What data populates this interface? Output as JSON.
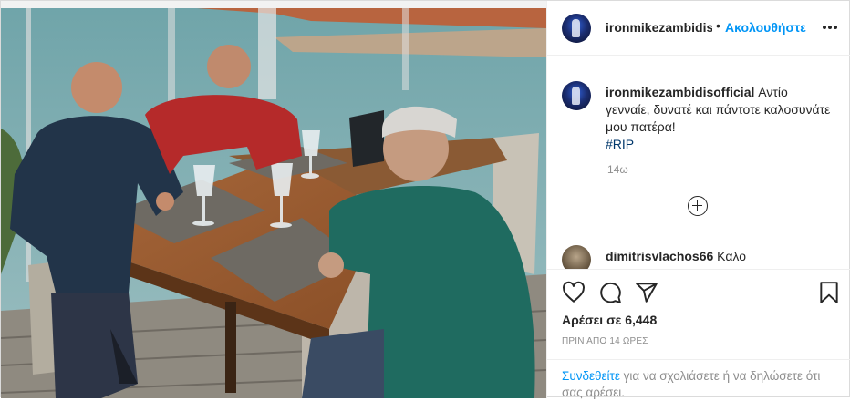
{
  "post": {
    "photo_alt": "Τέσσερις άνδρες κάθονται σε τραπέζι με θέα τη θάλασσα"
  },
  "header": {
    "username": "ironmikezambidisofficial",
    "separator": "•",
    "follow_label": "Ακολουθήστε",
    "more_icon": "more-horizontal-icon"
  },
  "caption": {
    "username": "ironmikezambidisofficial",
    "text": "Αντίο γενναίε, δυνατέ και πάντοτε καλοσυνάτε μου πατέρα!",
    "hashtag": "#RIP",
    "time": "14ω"
  },
  "load_more_icon": "plus-circle-icon",
  "comments": [
    {
      "username": "dimitrisvlachos66",
      "text": "Καλο"
    }
  ],
  "actions": {
    "like_icon": "heart-icon",
    "comment_icon": "comment-icon",
    "share_icon": "share-icon",
    "save_icon": "bookmark-icon"
  },
  "likes_text": "Αρέσει σε 6,448",
  "date_text": "ΠΡΙΝ ΑΠΟ 14 ΩΡΕΣ",
  "login": {
    "link_text": "Συνδεθείτε",
    "rest_text": " για να σχολιάσετε ή να δηλώσετε ότι σας αρέσει."
  },
  "colors": {
    "link_blue": "#0095f6",
    "text_dark": "#262626",
    "text_muted": "#8e8e8e",
    "border": "#dbdbdb"
  }
}
